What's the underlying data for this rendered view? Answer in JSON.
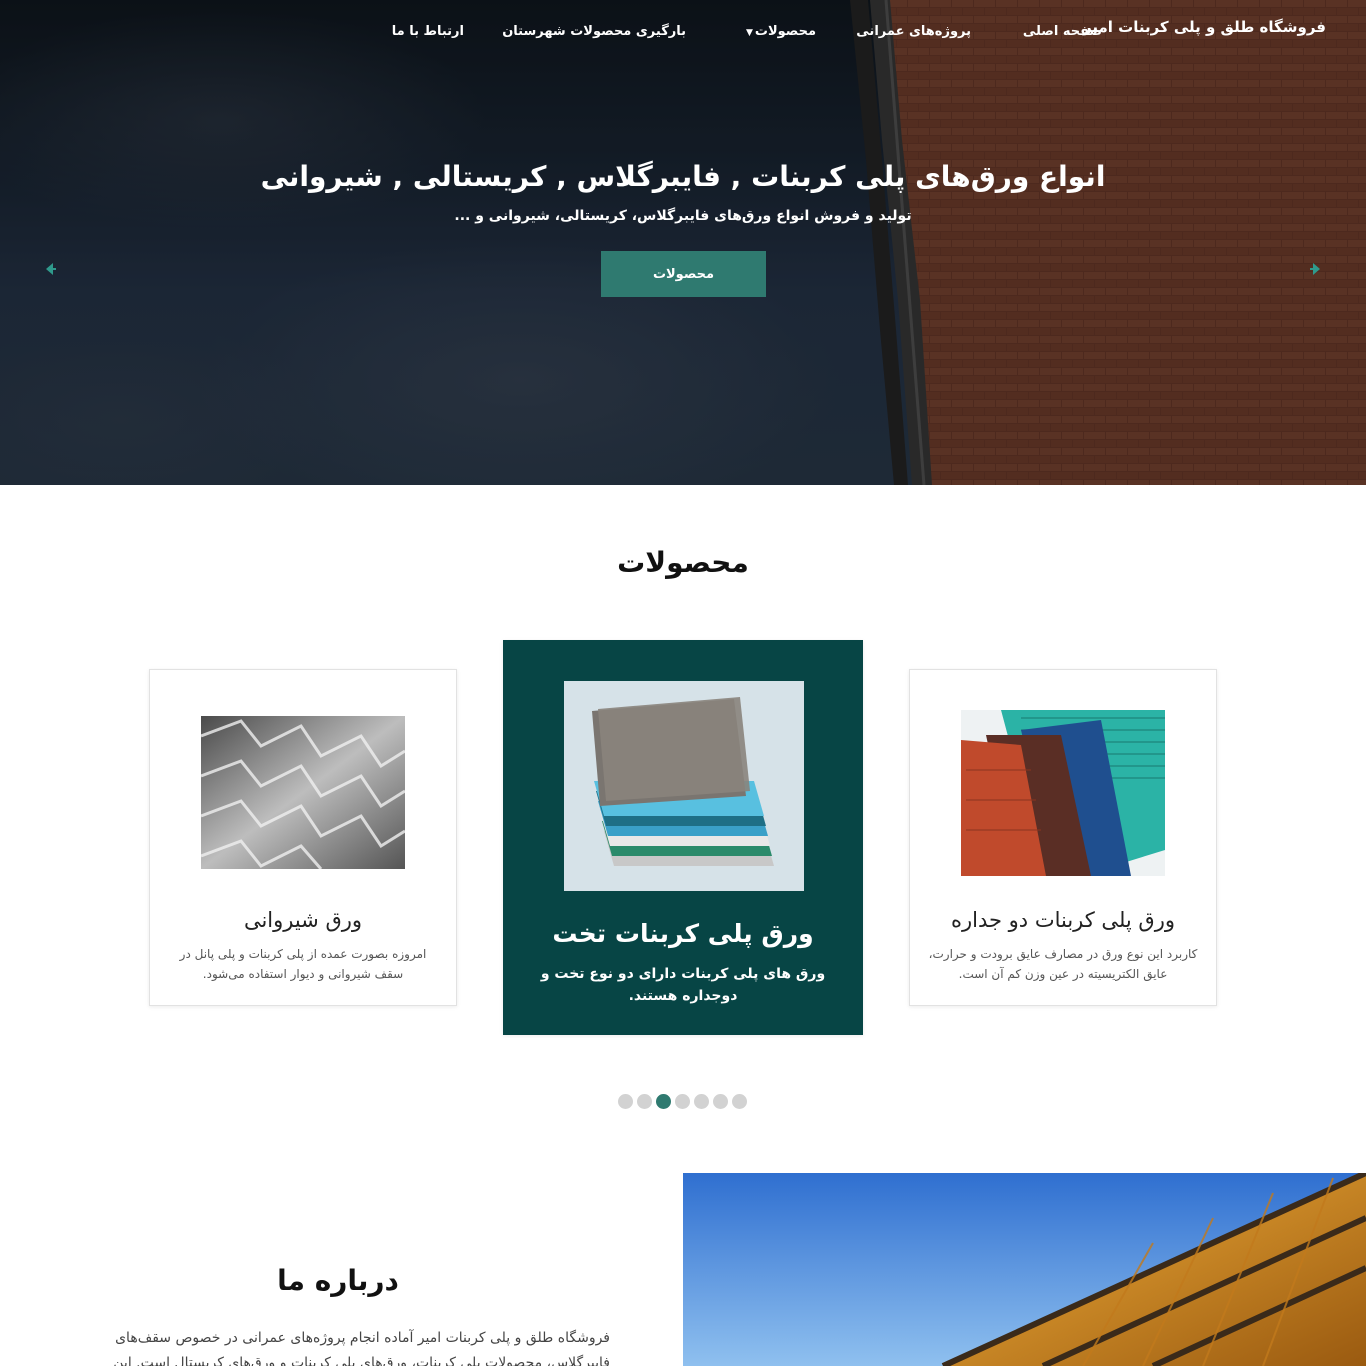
{
  "nav": {
    "brand": "فروشگاه طلق و پلی کربنات امیر",
    "items": [
      {
        "label": "صفحه اصلی"
      },
      {
        "label": "پروژه‌های عمرانی"
      },
      {
        "label": "محصولات",
        "dropdown": true
      },
      {
        "label": "بارگیری محصولات شهرستان"
      },
      {
        "label": "ارتباط با ما"
      }
    ]
  },
  "hero": {
    "title": "انواع ورق‌های پلی کربنات , فایبرگلاس , کریستالی , شیروانی",
    "subtitle": "تولید و فروش انواع ورق‌های فایبرگلاس، کریستالی، شیروانی و ...",
    "button": "محصولات",
    "prev_icon": "arrow-left-icon",
    "next_icon": "arrow-right-icon"
  },
  "products": {
    "title": "محصولات",
    "cards": [
      {
        "title": "ورق پلی کربنات دو جداره",
        "description": "کاربرد این نوع ورق در مصارف عایق برودت و حرارت، عایق الکتریسیته در عین وزن کم آن است."
      },
      {
        "title": "ورق پلی کربنات تخت",
        "description": "ورق های پلی کربنات دارای دو نوع تخت و دوجداره هستند."
      },
      {
        "title": "ورق شیروانی",
        "description": "امروزه بصورت عمده از پلی کربنات و پلی پانل در سقف شیروانی و دیوار استفاده می‌شود."
      }
    ],
    "dots_count": 7,
    "active_dot": 3
  },
  "about": {
    "title": "درباره ما",
    "text": "فروشگاه طلق و پلی کربنات امیر آماده انجام پروژه‌های عمرانی در خصوص سقف‌های فایبرگلاس، محصولات پلی کربنات، ورق‌های پلی کربنات و ورق‌های کریستال است. این"
  },
  "colors": {
    "accent": "#2f7a70",
    "card_highlight": "#074545"
  }
}
